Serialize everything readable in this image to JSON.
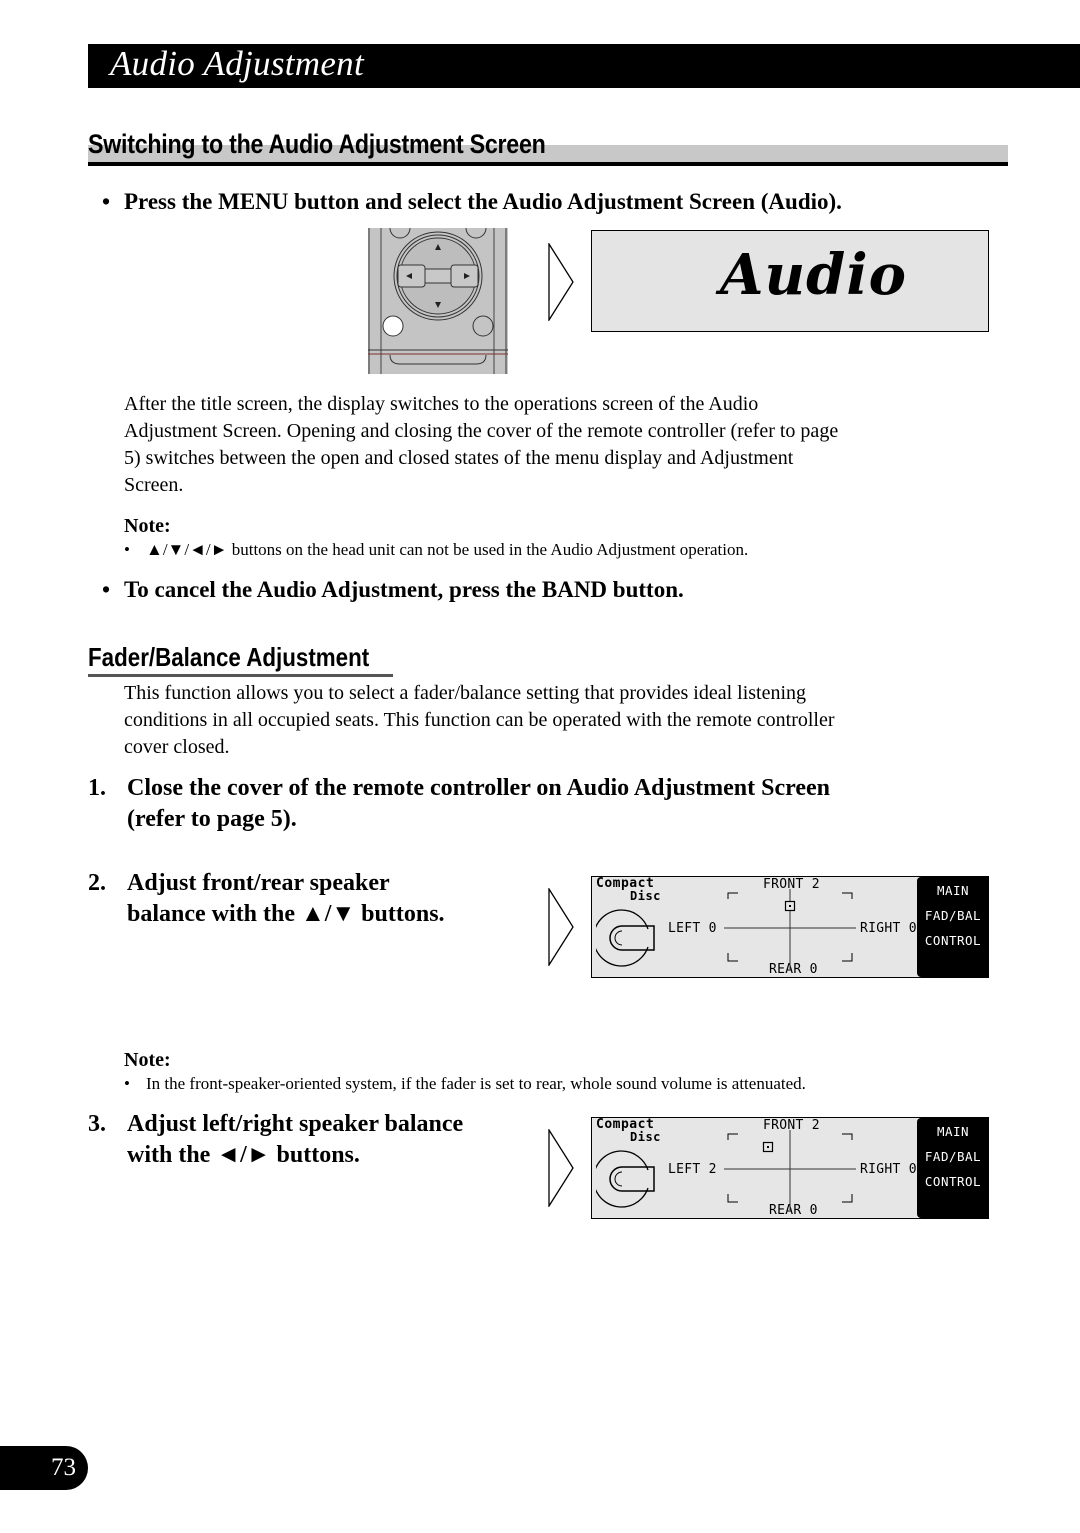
{
  "header": {
    "title": "Audio Adjustment"
  },
  "section1": {
    "heading": "Switching to the Audio Adjustment Screen",
    "bullet1": "Press the MENU button and select the Audio Adjustment Screen (Audio).",
    "display_title": "Audio",
    "remote_icons": [
      "up-arrow-icon",
      "down-arrow-icon",
      "left-arrow-icon",
      "right-arrow-icon"
    ],
    "paragraph": [
      "After the title screen, the display switches to the operations screen of the Audio",
      "Adjustment Screen. Opening and closing the cover of the remote controller (refer to page",
      "5) switches between the open and closed states of the menu display and Adjustment",
      "Screen."
    ],
    "note_label": "Note:",
    "note_bullet": "•",
    "note_text": "▲/▼/◄/► buttons on the head unit can not be used in the Audio Adjustment operation.",
    "bullet_char": "•",
    "bullet2": "To cancel the Audio Adjustment, press the BAND button."
  },
  "section2": {
    "heading": "Fader/Balance Adjustment",
    "paragraph": [
      "This function allows you to select a fader/balance setting that provides ideal listening",
      "conditions in all occupied seats. This function can be operated with the remote controller",
      "cover closed."
    ],
    "steps": [
      {
        "num": "1.",
        "lines": [
          "Close the cover of the remote controller on Audio Adjustment Screen",
          "(refer to page 5)."
        ]
      },
      {
        "num": "2.",
        "lines": [
          "Adjust front/rear speaker",
          "balance with the ▲/▼ buttons."
        ]
      },
      {
        "num": "3.",
        "lines": [
          "Adjust left/right speaker balance",
          "with the ◄/► buttons."
        ]
      }
    ],
    "note_label": "Note:",
    "note_bullet": "•",
    "note_text": "In the front-speaker-oriented system, if the fader is set to rear, whole sound volume is attenuated.",
    "displays": [
      {
        "source_line1": "Compact",
        "source_line2": "Disc",
        "front": "FRONT 2",
        "rear": "REAR 0",
        "left": "LEFT 0",
        "right": "RIGHT 0",
        "fader": 2,
        "balance": 0,
        "menu": [
          "MAIN",
          "FAD/BAL",
          "CONTROL"
        ]
      },
      {
        "source_line1": "Compact",
        "source_line2": "Disc",
        "front": "FRONT 2",
        "rear": "REAR 0",
        "left": "LEFT 2",
        "right": "RIGHT 0",
        "fader": 2,
        "balance": -2,
        "menu": [
          "MAIN",
          "FAD/BAL",
          "CONTROL"
        ]
      }
    ]
  },
  "footer": {
    "page_number": "73"
  }
}
